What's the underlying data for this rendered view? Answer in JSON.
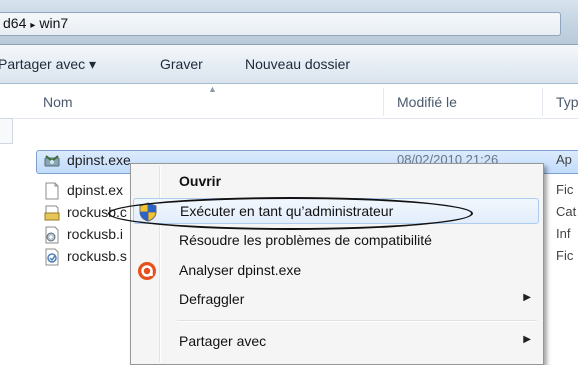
{
  "address": {
    "crumbs": [
      "d64",
      "win7"
    ],
    "separator": "▸"
  },
  "toolbar": {
    "share": "Partager avec ▾",
    "burn": "Graver",
    "new_folder": "Nouveau dossier"
  },
  "columns": {
    "name": "Nom",
    "modified": "Modifié le",
    "type": "Typ"
  },
  "files": [
    {
      "name": "dpinst.exe",
      "date": "08/02/2010 21:26",
      "type": "Ap",
      "icon": "installer-icon",
      "selected": true
    },
    {
      "name": "dpinst.ex",
      "date": "",
      "type": "Fic",
      "icon": "document-icon"
    },
    {
      "name": "rockusb.c",
      "date": "",
      "type": "Cat",
      "icon": "catalog-icon"
    },
    {
      "name": "rockusb.i",
      "date": "",
      "type": "Inf",
      "icon": "settings-file-icon"
    },
    {
      "name": "rockusb.s",
      "date": "",
      "type": "Fic",
      "icon": "system-file-icon"
    }
  ],
  "context_menu": {
    "open": "Ouvrir",
    "run_as_admin": "Exécuter en tant qu’administrateur",
    "troubleshoot": "Résoudre les problèmes de compatibilité",
    "analyze": "Analyser dpinst.exe",
    "defraggler": "Defraggler",
    "share_with": "Partager avec",
    "submenu_arrow": "▶"
  },
  "colors": {
    "highlight_border": "#7da2ce",
    "menu_bg": "#f5f5f5",
    "avast_orange": "#e8501b"
  }
}
